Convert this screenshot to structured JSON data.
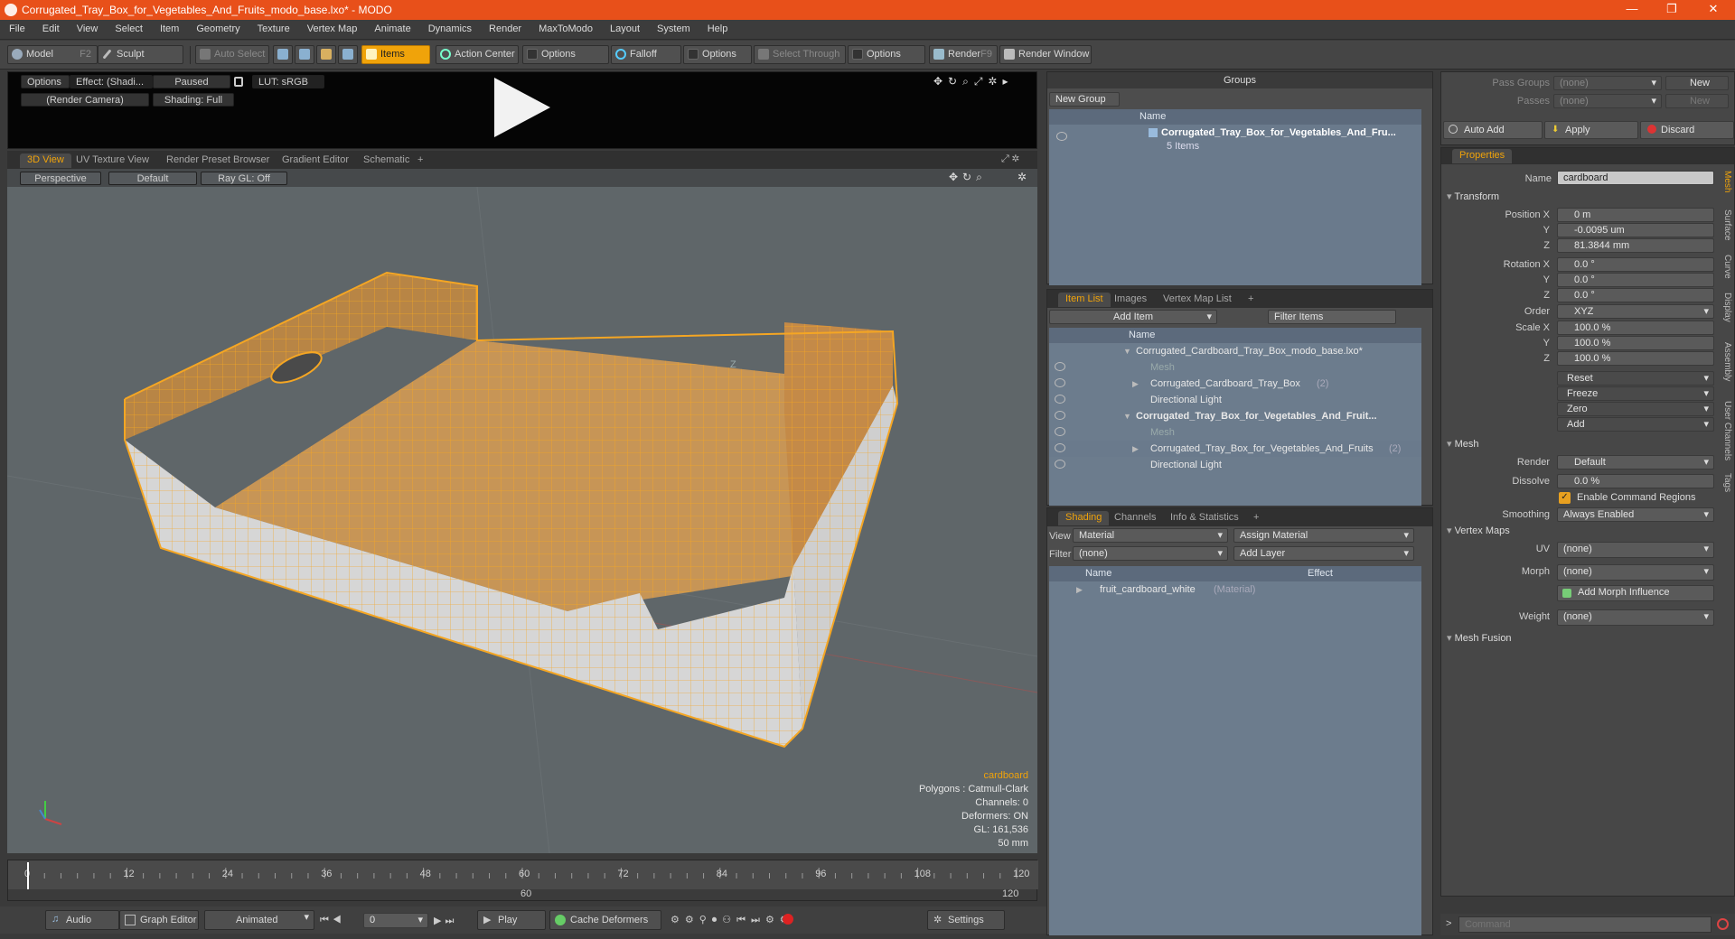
{
  "window": {
    "title": "Corrugated_Tray_Box_for_Vegetables_And_Fruits_modo_base.lxo* - MODO",
    "minimize": "—",
    "maximize": "❐",
    "close": "✕"
  },
  "menu": [
    "File",
    "Edit",
    "View",
    "Select",
    "Item",
    "Geometry",
    "Texture",
    "Vertex Map",
    "Animate",
    "Dynamics",
    "Render",
    "MaxToModo",
    "Layout",
    "System",
    "Help"
  ],
  "toolbar": {
    "model": "Model",
    "model_key": "F2",
    "sculpt": "Sculpt",
    "auto_select": "Auto Select",
    "items": "Items",
    "action_center": "Action Center",
    "options1": "Options",
    "falloff": "Falloff",
    "options2": "Options",
    "select_through": "Select Through",
    "options3": "Options",
    "render": "Render",
    "render_key": "F9",
    "render_window": "Render Window"
  },
  "preview": {
    "options": "Options",
    "effect": "Effect: (Shadi...",
    "paused": "Paused",
    "lut": "LUT: sRGB",
    "camera": "(Render Camera)",
    "shading": "Shading: Full"
  },
  "view_tabs": [
    "3D View",
    "UV Texture View",
    "Render Preset Browser",
    "Gradient Editor",
    "Schematic",
    "+"
  ],
  "viewport": {
    "projection": "Perspective",
    "style": "Default",
    "raygl": "Ray GL: Off",
    "axis_label": "Z"
  },
  "hud": {
    "selection": "cardboard",
    "polygons": "Polygons : Catmull-Clark",
    "channels": "Channels: 0",
    "deformers": "Deformers: ON",
    "gl": "GL: 161,536",
    "scale": "50 mm"
  },
  "timeline": {
    "ticks": [
      "0",
      "12",
      "24",
      "36",
      "48",
      "60",
      "72",
      "84",
      "96",
      "108",
      "120"
    ],
    "marker_mid": "60",
    "marker_end": "120"
  },
  "bottom": {
    "audio": "Audio",
    "graph_editor": "Graph Editor",
    "animated": "Animated",
    "frame": "0",
    "play": "Play",
    "cache": "Cache Deformers",
    "settings": "Settings"
  },
  "groups": {
    "title": "Groups",
    "new_group": "New Group",
    "col_name": "Name",
    "item_name": "Corrugated_Tray_Box_for_Vegetables_And_Fru...",
    "item_count": "5 Items"
  },
  "itemlist": {
    "tabs": [
      "Item List",
      "Images",
      "Vertex Map List",
      "+"
    ],
    "add_item": "Add Item",
    "filter": "Filter Items",
    "col_name": "Name",
    "rows": [
      {
        "name": "Corrugated_Cardboard_Tray_Box_modo_base.lxo*",
        "count": ""
      },
      {
        "name": "Mesh",
        "count": ""
      },
      {
        "name": "Corrugated_Cardboard_Tray_Box",
        "count": "(2)"
      },
      {
        "name": "Directional Light",
        "count": ""
      },
      {
        "name": "Corrugated_Tray_Box_for_Vegetables_And_Fruit...",
        "count": ""
      },
      {
        "name": "Mesh",
        "count": ""
      },
      {
        "name": "Corrugated_Tray_Box_for_Vegetables_And_Fruits",
        "count": "(2)"
      },
      {
        "name": "Directional Light",
        "count": ""
      }
    ]
  },
  "shading": {
    "tabs": [
      "Shading",
      "Channels",
      "Info & Statistics",
      "+"
    ],
    "view_label": "View",
    "view_value": "Material",
    "assign": "Assign Material",
    "filter_label": "Filter",
    "filter_value": "(none)",
    "add_layer": "Add Layer",
    "col_name": "Name",
    "col_effect": "Effect",
    "row_name": "fruit_cardboard_white",
    "row_type": "(Material)"
  },
  "pass": {
    "pass_groups": "Pass Groups",
    "passes": "Passes",
    "none": "(none)",
    "new": "New",
    "auto_add": "Auto Add",
    "apply": "Apply",
    "discard": "Discard"
  },
  "properties": {
    "tab": "Properties",
    "name_label": "Name",
    "name_value": "cardboard",
    "transform": "Transform",
    "pos_label": "Position X",
    "pos_x": "0 m",
    "pos_y": "-0.0095 um",
    "pos_z": "81.3844 mm",
    "rot_label": "Rotation X",
    "rot_x": "0.0 °",
    "rot_y": "0.0 °",
    "rot_z": "0.0 °",
    "order_label": "Order",
    "order": "XYZ",
    "scale_label": "Scale X",
    "scale_x": "100.0 %",
    "scale_y": "100.0 %",
    "scale_z": "100.0 %",
    "y": "Y",
    "z": "Z",
    "reset": "Reset",
    "freeze": "Freeze",
    "zero": "Zero",
    "add": "Add",
    "mesh": "Mesh",
    "render_label": "Render",
    "render": "Default",
    "dissolve_label": "Dissolve",
    "dissolve": "0.0 %",
    "enable_cmd": "Enable Command Regions",
    "smoothing_label": "Smoothing",
    "smoothing": "Always Enabled",
    "vertex_maps": "Vertex Maps",
    "uv_label": "UV",
    "uv": "(none)",
    "morph_label": "Morph",
    "morph": "(none)",
    "add_morph": "Add Morph Influence",
    "weight_label": "Weight",
    "weight": "(none)",
    "mesh_fusion": "Mesh Fusion",
    "side_tabs": [
      "Mesh",
      "Surface",
      "Curve",
      "Display",
      "Assembly",
      "User Channels",
      "Tags"
    ]
  },
  "command": {
    "prompt": ">",
    "placeholder": "Command"
  },
  "colors": {
    "accent": "#f0a30a",
    "title": "#e8501a",
    "wire": "#f5a623"
  }
}
